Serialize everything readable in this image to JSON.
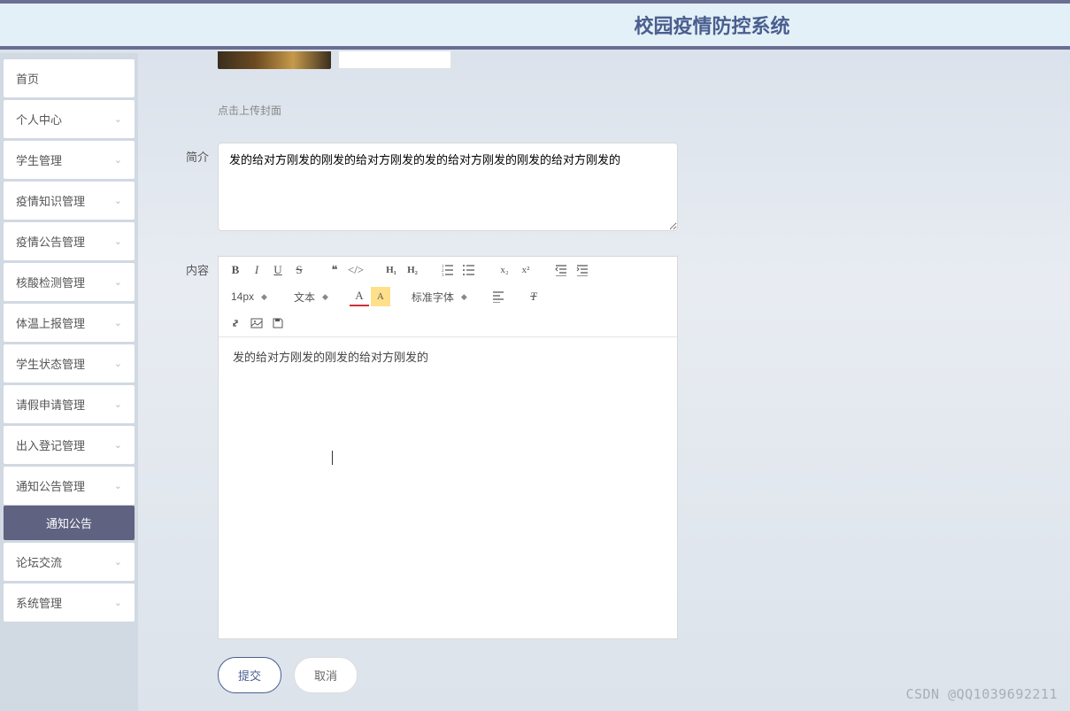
{
  "header": {
    "title": "校园疫情防控系统"
  },
  "sidebar": {
    "items": [
      {
        "label": "首页",
        "expandable": false
      },
      {
        "label": "个人中心",
        "expandable": true
      },
      {
        "label": "学生管理",
        "expandable": true
      },
      {
        "label": "疫情知识管理",
        "expandable": true
      },
      {
        "label": "疫情公告管理",
        "expandable": true
      },
      {
        "label": "核酸检测管理",
        "expandable": true
      },
      {
        "label": "体温上报管理",
        "expandable": true
      },
      {
        "label": "学生状态管理",
        "expandable": true
      },
      {
        "label": "请假申请管理",
        "expandable": true
      },
      {
        "label": "出入登记管理",
        "expandable": true
      },
      {
        "label": "通知公告管理",
        "expandable": true
      },
      {
        "label": "论坛交流",
        "expandable": true
      },
      {
        "label": "系统管理",
        "expandable": true
      }
    ],
    "active_sub": "通知公告"
  },
  "form": {
    "upload_hint": "点击上传封面",
    "intro_label": "简介",
    "intro_value": "发的给对方刚发的刚发的给对方刚发的发的给对方刚发的刚发的给对方刚发的",
    "content_label": "内容",
    "content_value": "发的给对方刚发的刚发的给对方刚发的"
  },
  "editor_toolbar": {
    "font_size": "14px",
    "text_style": "文本",
    "font_family": "标准字体"
  },
  "buttons": {
    "submit": "提交",
    "cancel": "取消"
  },
  "watermark": "CSDN @QQ1039692211"
}
